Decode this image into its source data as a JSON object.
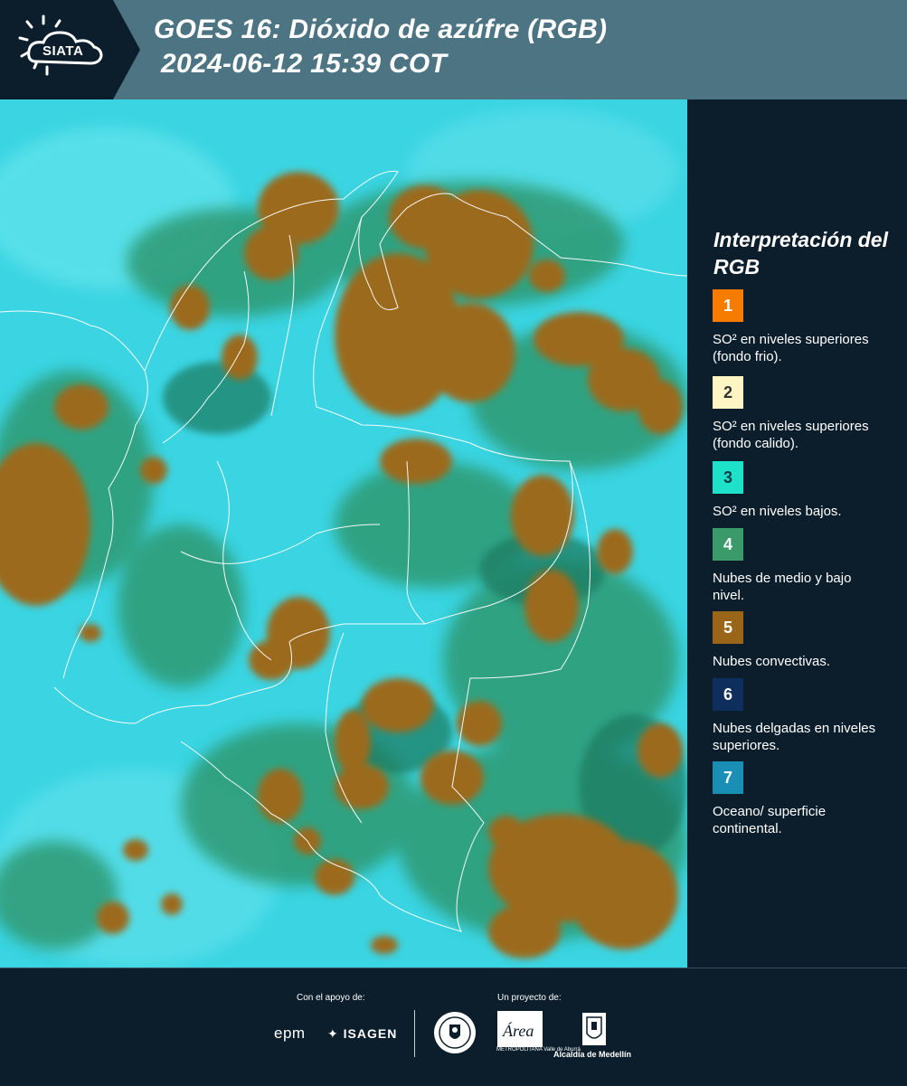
{
  "header": {
    "logo_text": "SIATA",
    "title_line1": "GOES 16: Dióxido de azúfre (RGB)",
    "title_line2": "2024-06-12 15:39 COT",
    "background": "#4d7483"
  },
  "map": {
    "colors": {
      "background": "#33ccdd",
      "convective": "#9c6a1e",
      "mid_low": "#2f8f6a",
      "borders": "#ffffff"
    }
  },
  "legend": {
    "title": "Interpretación del RGB",
    "items": [
      {
        "number": "1",
        "color": "#f57c00",
        "text_color": "#ffffff",
        "description": "SO² en niveles superiores (fondo frio)."
      },
      {
        "number": "2",
        "color": "#fdf5c4",
        "text_color": "#333333",
        "description": "SO² en niveles superiores (fondo calido)."
      },
      {
        "number": "3",
        "color": "#1de2c9",
        "text_color": "#0b3b44",
        "description": "SO² en niveles bajos."
      },
      {
        "number": "4",
        "color": "#3a9a6a",
        "text_color": "#ffffff",
        "description": "Nubes de medio y bajo nivel."
      },
      {
        "number": "5",
        "color": "#9a6518",
        "text_color": "#ffffff",
        "description": "Nubes convectivas."
      },
      {
        "number": "6",
        "color": "#0e2f5e",
        "text_color": "#ffffff",
        "description": "Nubes delgadas en niveles superiores."
      },
      {
        "number": "7",
        "color": "#1a8fb5",
        "text_color": "#ffffff",
        "description": "Oceano/ superficie continental."
      }
    ]
  },
  "footer": {
    "support_label": "Con el apoyo de:",
    "project_label": "Un proyecto de:",
    "sponsors": [
      "epm",
      "ISAGEN"
    ],
    "partners": [
      "Área",
      "METROPOLITANA Valle de Aburrá",
      "Alcaldía de Medellín"
    ]
  }
}
